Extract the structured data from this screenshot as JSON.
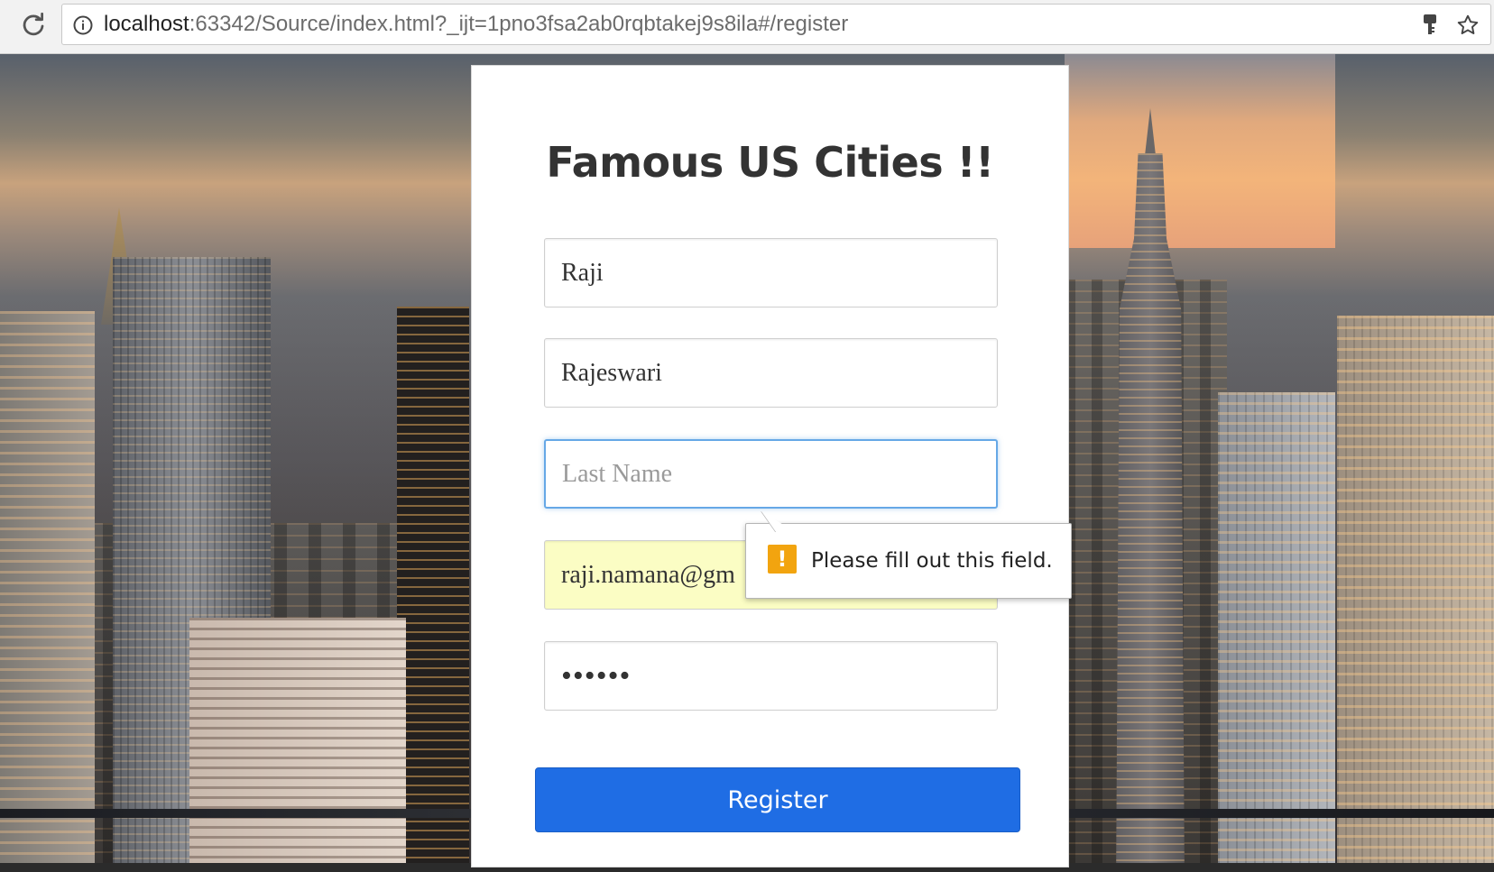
{
  "browser": {
    "url_host": "localhost",
    "url_rest": ":63342/Source/index.html?_ijt=1pno3fsa2ab0rqbtakej9s8ila#/register",
    "icons": [
      "reload-icon",
      "info-icon",
      "key-icon",
      "star-icon"
    ]
  },
  "page": {
    "title": "Famous US Cities !!",
    "background": "city skyline photo"
  },
  "form": {
    "field1": {
      "value": "Raji",
      "placeholder": ""
    },
    "field2": {
      "value": "Rajeswari",
      "placeholder": ""
    },
    "last_name": {
      "value": "",
      "placeholder": "Last Name"
    },
    "email": {
      "value": "raji.namana@gm",
      "placeholder": ""
    },
    "password": {
      "value": "••••••",
      "placeholder": ""
    },
    "register_label": "Register"
  },
  "validation": {
    "message": "Please fill out this field.",
    "icon": "warning-icon",
    "icon_glyph": "!"
  },
  "colors": {
    "button": "#1f6de4",
    "focus_border": "#66a8e6",
    "autofill": "#fbfdc4",
    "warning": "#f2a40f"
  }
}
